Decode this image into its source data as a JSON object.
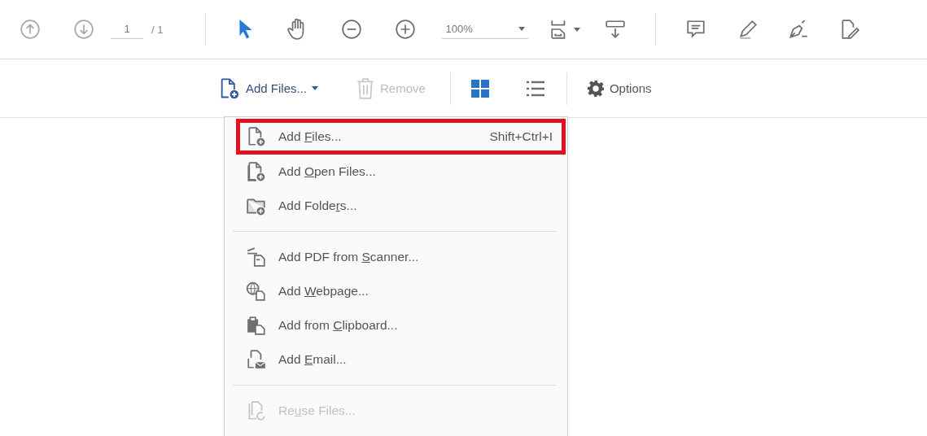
{
  "page_nav": {
    "page": "1",
    "total": "/ 1"
  },
  "tools": [
    {
      "kind": "pointer",
      "selected": true
    },
    {
      "kind": "hand",
      "selected": false
    }
  ],
  "zoom": {
    "value": "100%"
  },
  "files_toolbar": {
    "add_files": {
      "label": "Add Files..."
    },
    "remove": {
      "label": "Remove",
      "disabled": true
    },
    "views": [
      {
        "kind": "grid",
        "selected": true
      },
      {
        "kind": "list",
        "selected": false
      }
    ],
    "options": {
      "label": "Options"
    }
  },
  "menu": {
    "items": [
      {
        "kind": "item",
        "before": "Add ",
        "key": "F",
        "after": "iles...",
        "shortcut": "Shift+Ctrl+I",
        "selected": true,
        "disabled": false
      },
      {
        "kind": "item",
        "before": "Add ",
        "key": "O",
        "after": "pen Files...",
        "selected": false,
        "disabled": false
      },
      {
        "kind": "item",
        "before": "Add Folde",
        "key": "r",
        "after": "s...",
        "selected": false,
        "disabled": false
      },
      {
        "kind": "separator"
      },
      {
        "kind": "item",
        "before": "Add PDF from ",
        "key": "S",
        "after": "canner...",
        "selected": false,
        "disabled": false
      },
      {
        "kind": "item",
        "before": "Add ",
        "key": "W",
        "after": "ebpage...",
        "selected": false,
        "disabled": false
      },
      {
        "kind": "item",
        "before": "Add from ",
        "key": "C",
        "after": "lipboard...",
        "selected": false,
        "disabled": false
      },
      {
        "kind": "item",
        "before": "Add ",
        "key": "E",
        "after": "mail...",
        "selected": false,
        "disabled": false
      },
      {
        "kind": "separator"
      },
      {
        "kind": "item",
        "before": "Re",
        "key": "u",
        "after": "se Files...",
        "selected": false,
        "disabled": true
      }
    ]
  }
}
